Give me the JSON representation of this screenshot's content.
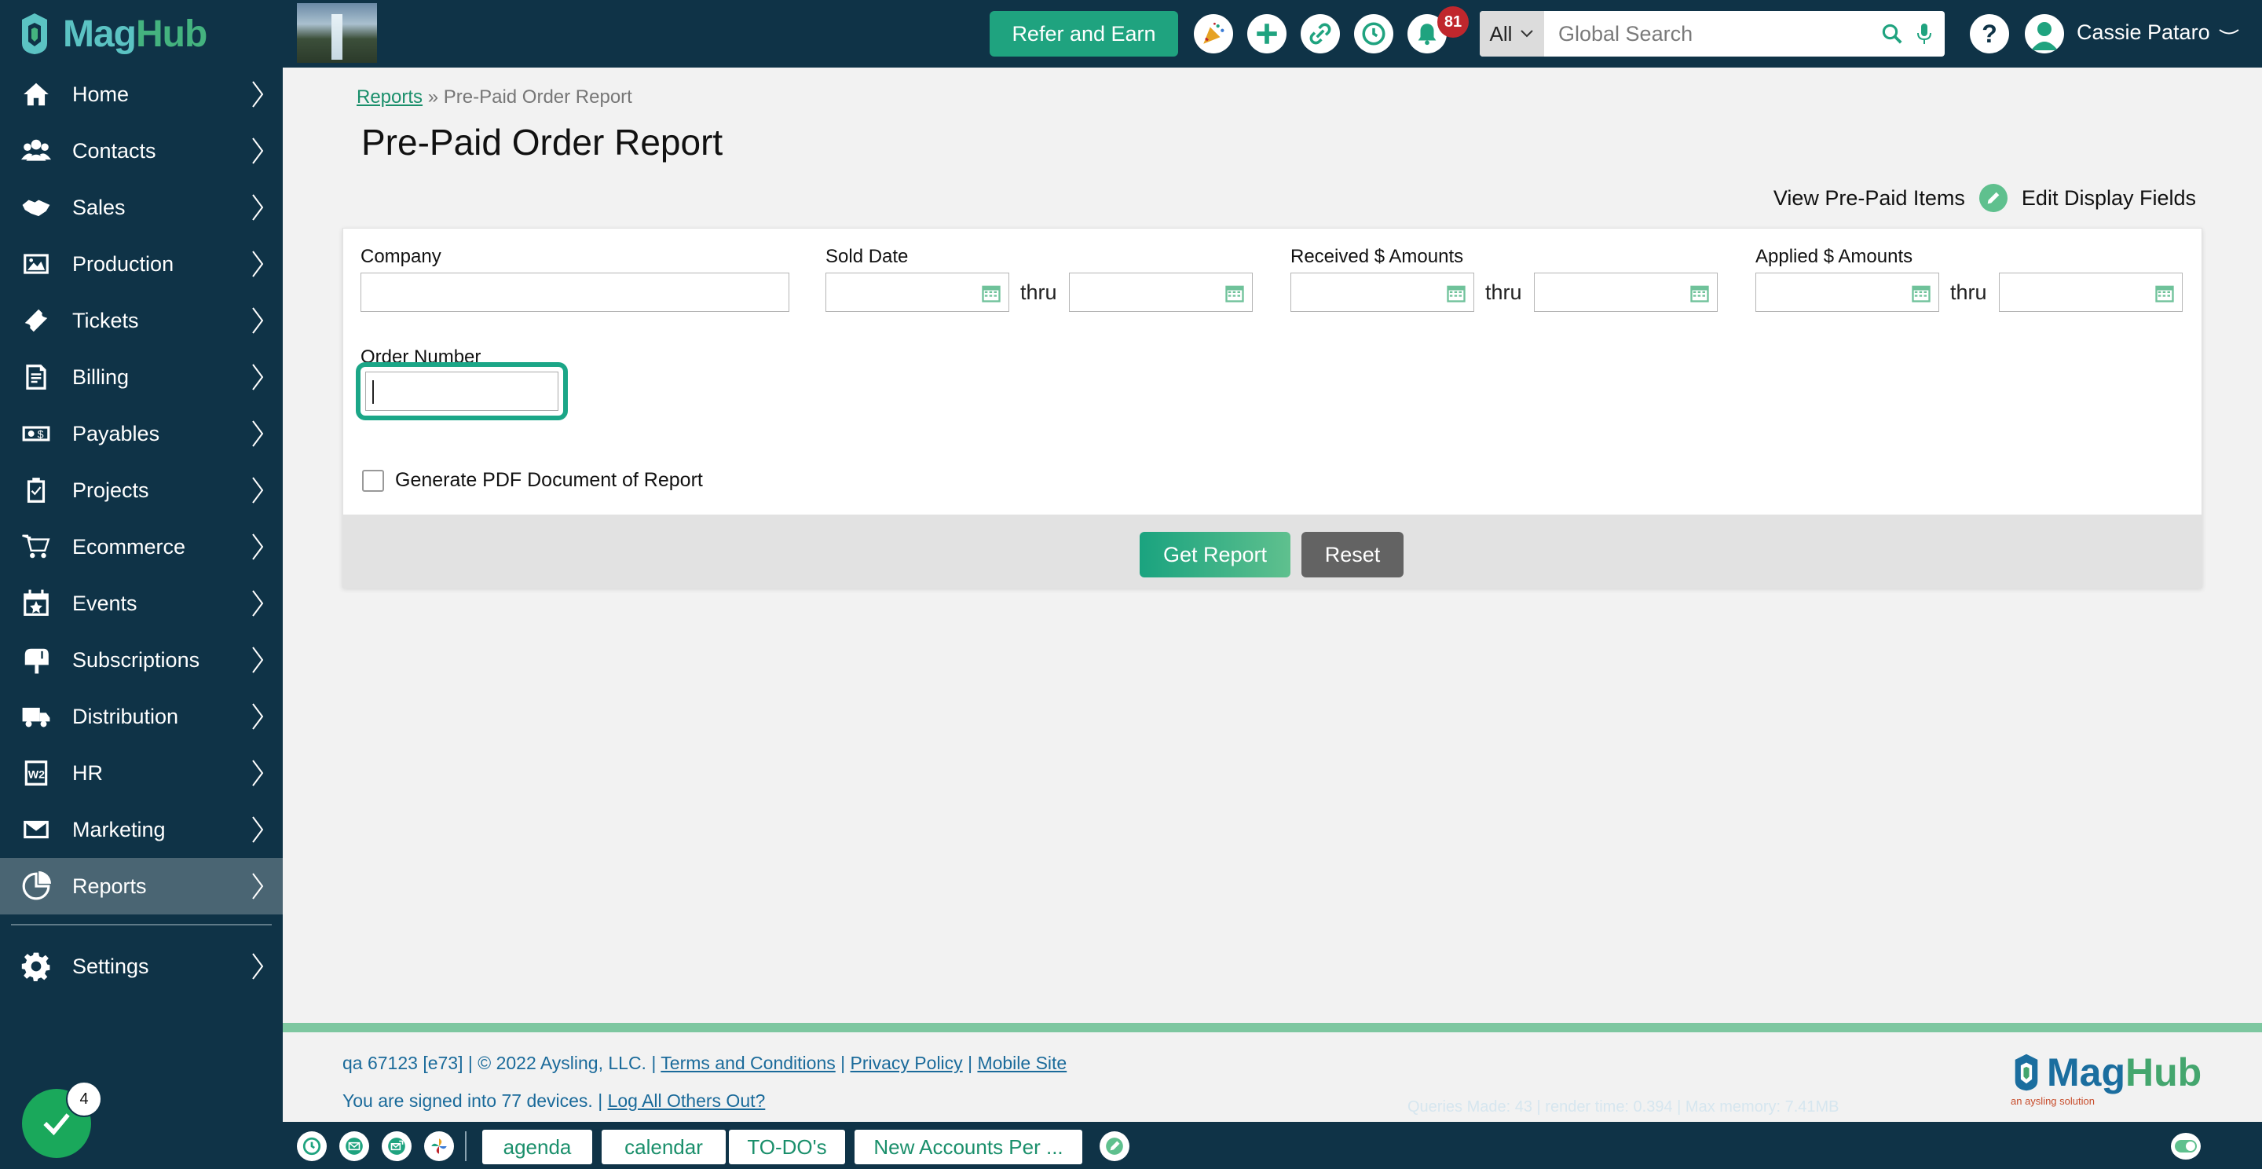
{
  "app": {
    "logo_mag": "Mag",
    "logo_hub": "Hub"
  },
  "sidebar": {
    "items": [
      {
        "label": "Home",
        "icon": "home-icon"
      },
      {
        "label": "Contacts",
        "icon": "contacts-icon"
      },
      {
        "label": "Sales",
        "icon": "handshake-icon"
      },
      {
        "label": "Production",
        "icon": "image-icon"
      },
      {
        "label": "Tickets",
        "icon": "ticket-icon"
      },
      {
        "label": "Billing",
        "icon": "invoice-icon"
      },
      {
        "label": "Payables",
        "icon": "payables-icon"
      },
      {
        "label": "Projects",
        "icon": "clipboard-check-icon"
      },
      {
        "label": "Ecommerce",
        "icon": "cart-icon"
      },
      {
        "label": "Events",
        "icon": "calendar-star-icon"
      },
      {
        "label": "Subscriptions",
        "icon": "mailbox-icon"
      },
      {
        "label": "Distribution",
        "icon": "truck-icon"
      },
      {
        "label": "HR",
        "icon": "w2-icon"
      },
      {
        "label": "Marketing",
        "icon": "envelope-icon"
      },
      {
        "label": "Reports",
        "icon": "reports-icon",
        "active": true
      }
    ],
    "settings_label": "Settings",
    "status_count": "4"
  },
  "topbar": {
    "refer_label": "Refer and Earn",
    "notification_count": "81",
    "search_scope": "All",
    "search_placeholder": "Global Search",
    "help_label": "?",
    "user_name": "Cassie Pataro"
  },
  "page": {
    "breadcrumb_parent": "Reports",
    "breadcrumb_sep": "»",
    "breadcrumb_current": "Pre-Paid Order Report",
    "title": "Pre-Paid Order Report",
    "view_items_link": "View Pre-Paid Items",
    "edit_fields_link": "Edit Display Fields"
  },
  "form": {
    "company_label": "Company",
    "sold_date_label": "Sold Date",
    "received_label": "Received $ Amounts",
    "applied_label": "Applied $ Amounts",
    "thru_label": "thru",
    "order_number_label": "Order Number",
    "order_number_value": "",
    "pdf_label": "Generate PDF Document of Report",
    "get_report_label": "Get Report",
    "reset_label": "Reset"
  },
  "footer": {
    "line1_prefix": "qa 67123 [e73] | © 2022 Aysling, LLC. |",
    "terms": "Terms and Conditions",
    "privacy": "Privacy Policy",
    "mobile": "Mobile Site",
    "sep": "|",
    "signed_in": "You are signed into 77 devices. |",
    "log_out": "Log All Others Out?",
    "faint_text": "Queries Made: 43 | render time: 0.394 | Max memory: 7.41MB",
    "logo_mag": "Mag",
    "logo_hub": "Hub",
    "logo_sub": "an aysling solution"
  },
  "bottombar": {
    "tabs": [
      "agenda",
      "calendar",
      "TO-DO's",
      "New Accounts Per ..."
    ]
  },
  "colors": {
    "navy": "#0f3347",
    "accent_green": "#1fa37f",
    "active_nav": "#4a6573",
    "badge_red": "#c0272d"
  }
}
